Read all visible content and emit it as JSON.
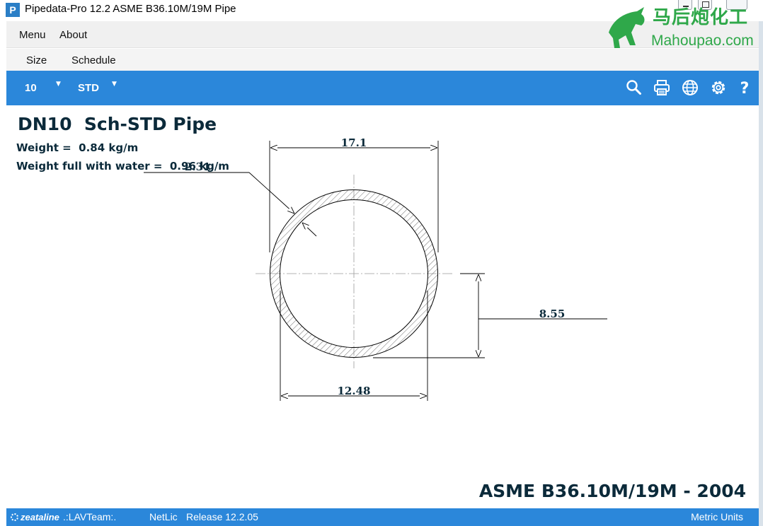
{
  "window": {
    "title": "Pipedata-Pro 12.2 ASME B36.10M/19M Pipe",
    "app_icon_letter": "P"
  },
  "watermark": {
    "chinese": "马后炮化工",
    "site": "Mahoupao.com"
  },
  "menubar": {
    "menu_label": "Menu",
    "about_label": "About"
  },
  "tabs": {
    "size_label": "Size",
    "schedule_label": "Schedule"
  },
  "toolbar": {
    "size_value": "10",
    "schedule_value": "STD",
    "icons": [
      "search-icon",
      "print-icon",
      "globe-icon",
      "gear-icon",
      "help-icon"
    ],
    "help_glyph": "?"
  },
  "content": {
    "title": "DN10  Sch-STD Pipe",
    "weight": "Weight =  0.84 kg/m",
    "weight_water": "Weight full with water =  0.96 kg/m",
    "standard": "ASME B36.10M/19M - 2004"
  },
  "drawing": {
    "outside_diameter": "17.1",
    "inside_diameter": "12.48",
    "wall_thickness": "2.31",
    "radius": "8.55"
  },
  "statusbar": {
    "logo": "zeataline",
    "team": ".:LAVTeam:.",
    "license": "NetLic",
    "release": "Release 12.2.05",
    "units": "Metric Units"
  },
  "colors": {
    "accent": "#2b87da",
    "heading_text": "#0b2a3a",
    "watermark": "#2fa84a"
  }
}
